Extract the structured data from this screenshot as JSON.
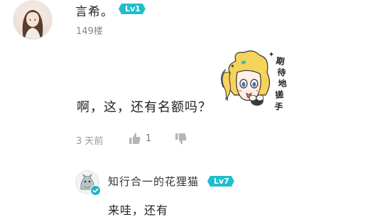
{
  "comment": {
    "username": "言希。",
    "level": "Lv1",
    "floor": "149楼",
    "sticker_text": "期待地搓手",
    "content": "啊，这，还有名额吗？",
    "time": "3 天前",
    "like_count": "1",
    "icons": {
      "like": "thumbs-up-icon",
      "dislike": "thumbs-down-icon"
    }
  },
  "reply": {
    "username": "知行合一的花狸猫",
    "level": "Lv7",
    "content": "来哇，还有"
  },
  "colors": {
    "level_badge": "#1ebfc9",
    "muted_text": "#999999",
    "icon_gray": "#b5b5b5"
  }
}
